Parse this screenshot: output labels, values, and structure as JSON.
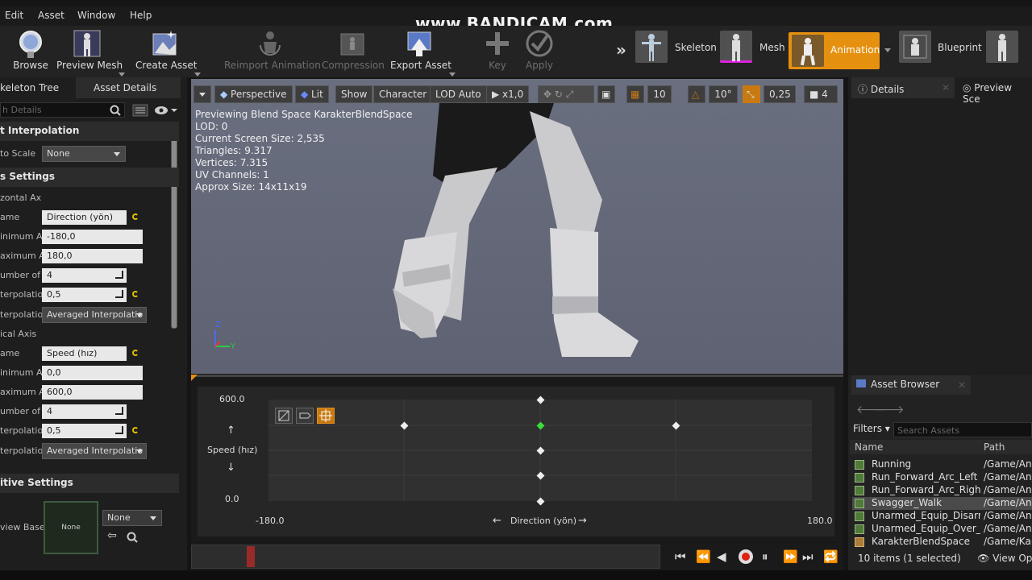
{
  "menu": [
    "Edit",
    "Asset",
    "Window",
    "Help"
  ],
  "watermark": "www.BANDICAM.com",
  "toolbar": {
    "browse": "Browse",
    "preview_mesh": "Preview Mesh",
    "create_asset": "Create Asset",
    "reimport": "Reimport Animation",
    "compression": "Compression",
    "export": "Export Asset",
    "key": "Key",
    "apply": "Apply",
    "modes": [
      "Skeleton",
      "Mesh",
      "Animation",
      "Blueprint"
    ]
  },
  "left_tabs": [
    "keleton Tree",
    "Asset Details"
  ],
  "search_placeholder": "h Details",
  "sections": {
    "input_interp": "t Interpolation",
    "axis_settings": "s Settings",
    "additive": "itive Settings"
  },
  "props": {
    "scale_label": "to Scale",
    "scale_value": "None",
    "horizontal_label": "zontal Ax",
    "h_name_label": "ame",
    "h_name": "Direction (yön)",
    "h_min_label": "inimum A",
    "h_min": "-180,0",
    "h_max_label": "aximum A",
    "h_max": "180,0",
    "h_grid_label": "umber of G",
    "h_grid": "4",
    "h_interp_time_label": "terpolatio",
    "h_interp_time": "0,5",
    "h_interp_type_label": "terpolatio",
    "h_interp_type": "Averaged Interpolatio",
    "vertical_label": "ical Axis",
    "v_name_label": "ame",
    "v_name": "Speed (hız)",
    "v_min_label": "inimum A",
    "v_min": "0,0",
    "v_max_label": "aximum A",
    "v_max": "600,0",
    "v_grid_label": "umber of G",
    "v_grid": "4",
    "v_interp_time_label": "terpolatio",
    "v_interp_time": "0,5",
    "v_interp_type_label": "terpolatio",
    "v_interp_type": "Averaged Interpolatio",
    "base_label": "view Base",
    "base_thumb": "None",
    "base_value": "None"
  },
  "viewport": {
    "perspective": "Perspective",
    "lit": "Lit",
    "show": "Show",
    "character": "Character",
    "lod": "LOD Auto",
    "speed": "x1,0",
    "grid": "10",
    "angle": "10°",
    "scale": "0,25",
    "cam": "4",
    "stats": [
      "Previewing Blend Space KarakterBlendSpace",
      "LOD: 0",
      "Current Screen Size: 2,535",
      "Triangles: 9.317",
      "Vertices: 7.315",
      "UV Channels: 1",
      "Approx Size: 14x11x19"
    ],
    "axis_z": "Z",
    "axis_y": "Y"
  },
  "graph": {
    "y_max": "600.0",
    "y_min": "0.0",
    "y_label": "Speed (hız)",
    "x_min": "-180.0",
    "x_max": "180.0",
    "x_label": "Direction (yön)"
  },
  "right": {
    "details_tab": "Details",
    "preview_tab": "Preview Sce"
  },
  "asset_browser": {
    "tab": "Asset Browser",
    "filters": "Filters",
    "search_placeholder": "Search Assets",
    "col_name": "Name",
    "col_path": "Path",
    "rows": [
      {
        "name": "Running",
        "path": "/Game/Ani"
      },
      {
        "name": "Run_Forward_Arc_Left",
        "path": "/Game/Ani"
      },
      {
        "name": "Run_Forward_Arc_Right",
        "path": "/Game/Ani"
      },
      {
        "name": "Swagger_Walk",
        "path": "/Game/Ani"
      },
      {
        "name": "Unarmed_Equip_Disarm_",
        "path": "/Game/Ani"
      },
      {
        "name": "Unarmed_Equip_Over_Sh",
        "path": "/Game/Ani"
      },
      {
        "name": "KarakterBlendSpace",
        "path": "/Game/Kar"
      }
    ],
    "status": "10 items (1 selected)",
    "view_options": "View Opt"
  }
}
